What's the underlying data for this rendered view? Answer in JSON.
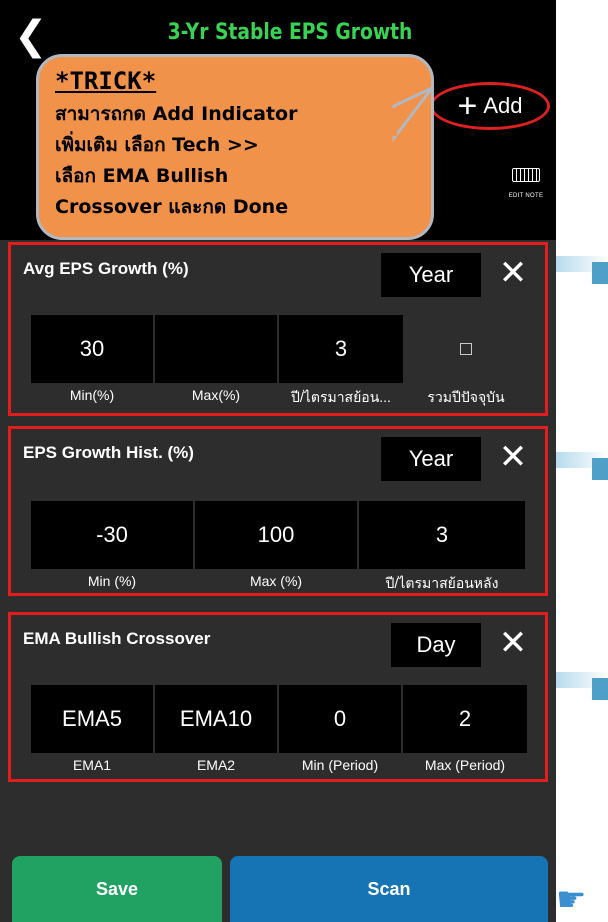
{
  "header": {
    "back_icon": "chevron-left-icon",
    "title": "3-Yr Stable EPS Growth",
    "add_label": "Add",
    "add_icon": "plus-icon",
    "edit_note_label": "EDIT NOTE",
    "edit_note_icon": "keyboard-icon"
  },
  "trick": {
    "title": "*TRICK*",
    "lines": [
      "สามารถกด Add Indicator",
      "เพิ่มเติม เลือก Tech >>",
      "เลือก EMA Bullish",
      "Crossover และกด Done"
    ]
  },
  "cards": [
    {
      "name": "Avg EPS Growth (%)",
      "period": "Year",
      "fields": [
        {
          "value": "30",
          "caption": "Min(%)"
        },
        {
          "value": "",
          "caption": "Max(%)"
        },
        {
          "value": "3",
          "caption": "ปี/ไตรมาสย้อน..."
        },
        {
          "value": "",
          "caption": "รวมปีปัจจุบัน",
          "checkbox": true,
          "checked": false
        }
      ]
    },
    {
      "name": "EPS Growth Hist. (%)",
      "period": "Year",
      "fields": [
        {
          "value": "-30",
          "caption": "Min (%)"
        },
        {
          "value": "100",
          "caption": "Max (%)"
        },
        {
          "value": "3",
          "caption": "ปี/ไตรมาสย้อนหลัง"
        }
      ]
    },
    {
      "name": "EMA Bullish Crossover",
      "period": "Day",
      "fields": [
        {
          "value": "EMA5",
          "caption": "EMA1"
        },
        {
          "value": "EMA10",
          "caption": "EMA2"
        },
        {
          "value": "0",
          "caption": "Min (Period)"
        },
        {
          "value": "2",
          "caption": "Max (Period)"
        }
      ]
    }
  ],
  "footer": {
    "save_label": "Save",
    "scan_label": "Scan"
  },
  "colors": {
    "title_green": "#39d353",
    "highlight_red": "#e11d1d",
    "save_green": "#21a262",
    "scan_blue": "#1673b4",
    "trick_orange": "#f0924a"
  }
}
